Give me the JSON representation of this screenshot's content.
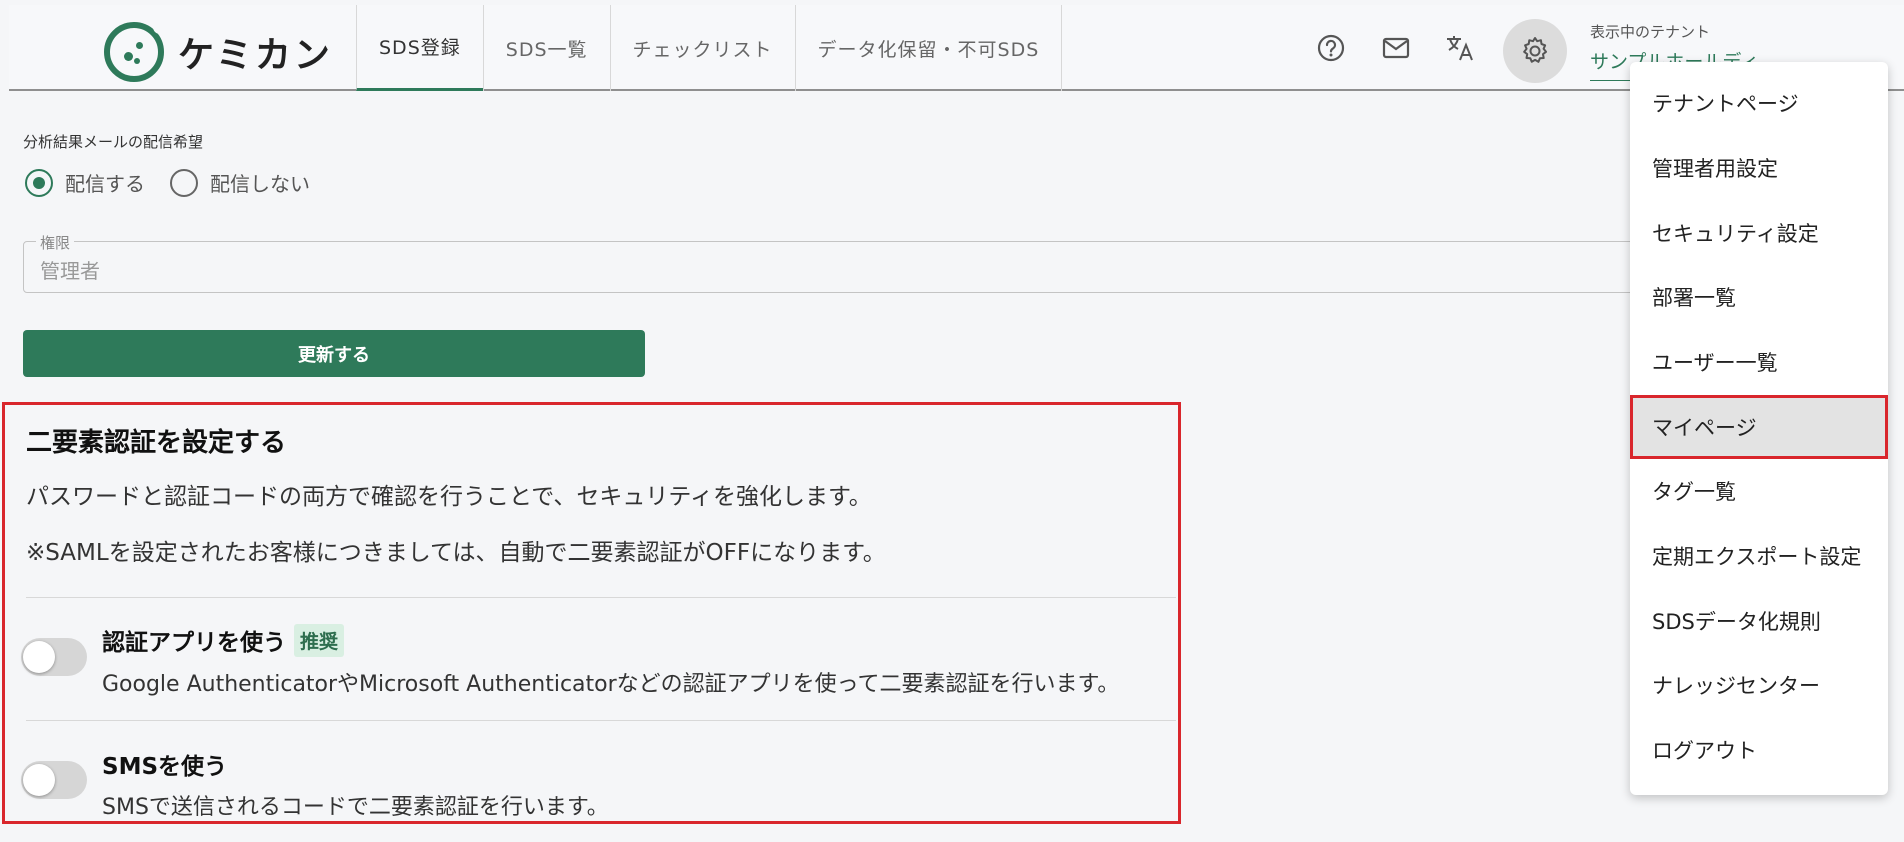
{
  "header": {
    "logo_text": "ケミカン",
    "tabs": [
      {
        "label": "SDS登録"
      },
      {
        "label": "SDS一覧"
      },
      {
        "label": "チェックリスト"
      },
      {
        "label": "データ化保留・不可SDS"
      }
    ],
    "icons": [
      "help-icon",
      "mail-icon",
      "translate-icon",
      "gear-icon"
    ],
    "tenant_label": "表示中のテナント",
    "tenant_value": "サンプルホールディ"
  },
  "form": {
    "mail_pref_label": "分析結果メールの配信希望",
    "radio_options": [
      {
        "label": "配信する",
        "checked": true
      },
      {
        "label": "配信しない",
        "checked": false
      }
    ],
    "permission_label": "権限",
    "permission_value": "管理者",
    "update_button": "更新する"
  },
  "two_factor": {
    "title": "二要素認証を設定する",
    "description": "パスワードと認証コードの両方で確認を行うことで、セキュリティを強化します。",
    "note": "※SAMLを設定されたお客様につきましては、自動で二要素認証がOFFになります。",
    "options": [
      {
        "title": "認証アプリを使う",
        "badge": "推奨",
        "description": "Google AuthenticatorやMicrosoft Authenticatorなどの認証アプリを使って二要素認証を行います。",
        "enabled": false
      },
      {
        "title": "SMSを使う",
        "badge": "",
        "description": "SMSで送信されるコードで二要素認証を行います。",
        "enabled": false
      }
    ]
  },
  "settings_menu": {
    "items": [
      {
        "label": "テナントページ"
      },
      {
        "label": "管理者用設定"
      },
      {
        "label": "セキュリティ設定"
      },
      {
        "label": "部署一覧"
      },
      {
        "label": "ユーザー一覧"
      },
      {
        "label": "マイページ",
        "selected": true
      },
      {
        "label": "タグ一覧"
      },
      {
        "label": "定期エクスポート設定"
      },
      {
        "label": "SDSデータ化規則"
      },
      {
        "label": "ナレッジセンター"
      },
      {
        "label": "ログアウト"
      }
    ]
  },
  "colors": {
    "brand": "#2e7a5a",
    "highlight": "#d9262c"
  }
}
